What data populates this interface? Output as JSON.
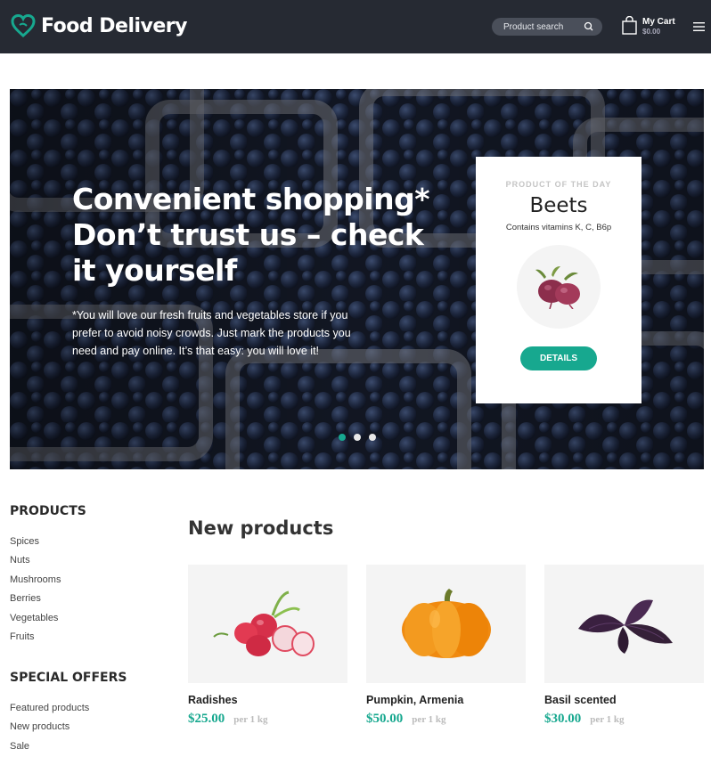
{
  "header": {
    "brand": "Food Delivery",
    "search_placeholder": "Product search",
    "cart_label": "My Cart",
    "cart_total": "$0.00",
    "accent": "#17a88f",
    "background": "#262a33"
  },
  "hero": {
    "title_lines": [
      "Convenient shopping*",
      "Don’t trust us – check",
      "it yourself"
    ],
    "text": "*You will love our fresh fruits and vegetables store if you prefer to avoid noisy crowds. Just mark the products you need and pay online. It’s that easy: you will love it!",
    "product_of_day": {
      "label": "PRODUCT OF THE DAY",
      "name": "Beets",
      "subtitle": "Contains vitamins K, C, B6p",
      "button": "DETAILS"
    }
  },
  "sidebar": {
    "products_heading": "PRODUCTS",
    "products": [
      "Spices",
      "Nuts",
      "Mushrooms",
      "Berries",
      "Vegetables",
      "Fruits"
    ],
    "offers_heading": "SPECIAL OFFERS",
    "offers": [
      "Featured products",
      "New products",
      "Sale"
    ]
  },
  "new_products": {
    "title": "New products",
    "items": [
      {
        "name": "Radishes",
        "price": "$25.00",
        "unit": "per 1 kg",
        "icon": "radish-image"
      },
      {
        "name": "Pumpkin, Armenia",
        "price": "$50.00",
        "unit": "per 1 kg",
        "icon": "pumpkin-image"
      },
      {
        "name": "Basil scented",
        "price": "$30.00",
        "unit": "per 1 kg",
        "icon": "basil-image"
      }
    ]
  }
}
